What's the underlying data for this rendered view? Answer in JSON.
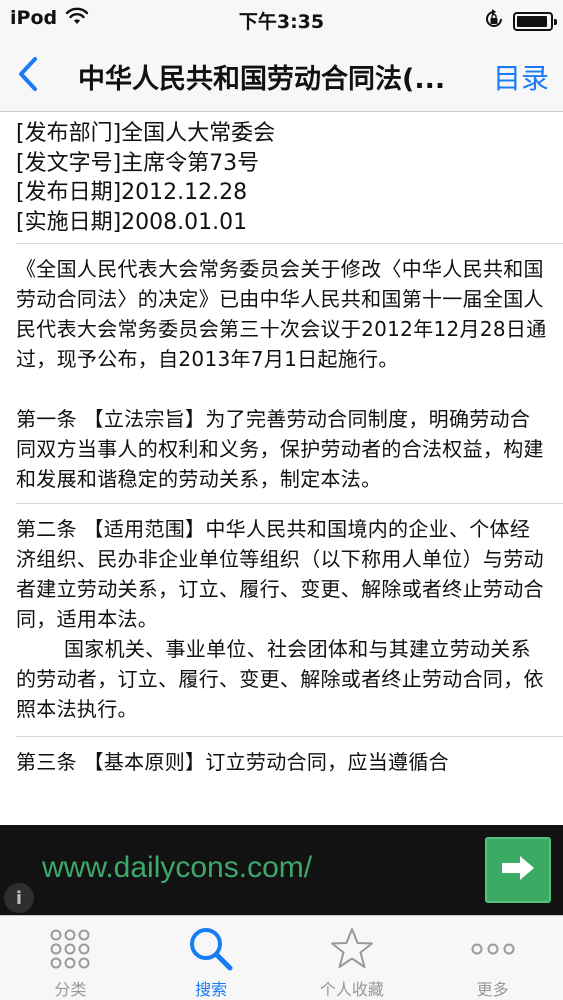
{
  "status_bar": {
    "carrier": "iPod",
    "time": "下午3:35",
    "battery_level": 0.95
  },
  "nav": {
    "back_icon": "chevron-left-icon",
    "title": "中华人民共和国劳动合同法(...",
    "right_button": "目录"
  },
  "meta": {
    "department": "[发布部门]全国人大常委会",
    "doc_number": "[发文字号]主席令第73号",
    "publish_date": "[发布日期]2012.12.28",
    "effective_date": "[实施日期]2008.01.01"
  },
  "sections": {
    "intro": "《全国人民代表大会常务委员会关于修改〈中华人民共和国劳动合同法〉的决定》已由中华人民共和国第十一届全国人民代表大会常务委员会第三十次会议于2012年12月28日通过，现予公布，自2013年7月1日起施行。",
    "article1": "第一条 【立法宗旨】为了完善劳动合同制度，明确劳动合同双方当事人的权利和义务，保护劳动者的合法权益，构建和发展和谐稳定的劳动关系，制定本法。",
    "article2_p1": "第二条 【适用范围】中华人民共和国境内的企业、个体经济组织、民办非企业单位等组织（以下称用人单位）与劳动者建立劳动关系，订立、履行、变更、解除或者终止劳动合同，适用本法。",
    "article2_p2": "国家机关、事业单位、社会团体和与其建立劳动关系的劳动者，订立、履行、变更、解除或者终止劳动合同，依照本法执行。",
    "article3_partial": "第三条 【基本原则】订立劳动合同，应当遵循合"
  },
  "ad": {
    "url_text": "www.dailycons.com/",
    "info_label": "i"
  },
  "tabs": [
    {
      "label": "分类",
      "icon": "grid-dots-icon",
      "active": false
    },
    {
      "label": "搜索",
      "icon": "search-icon",
      "active": true
    },
    {
      "label": "个人收藏",
      "icon": "star-icon",
      "active": false
    },
    {
      "label": "更多",
      "icon": "more-dots-icon",
      "active": false
    }
  ],
  "colors": {
    "accent": "#1a7cf5",
    "ad_green": "#3ea86c",
    "ad_button": "#3bab64"
  }
}
